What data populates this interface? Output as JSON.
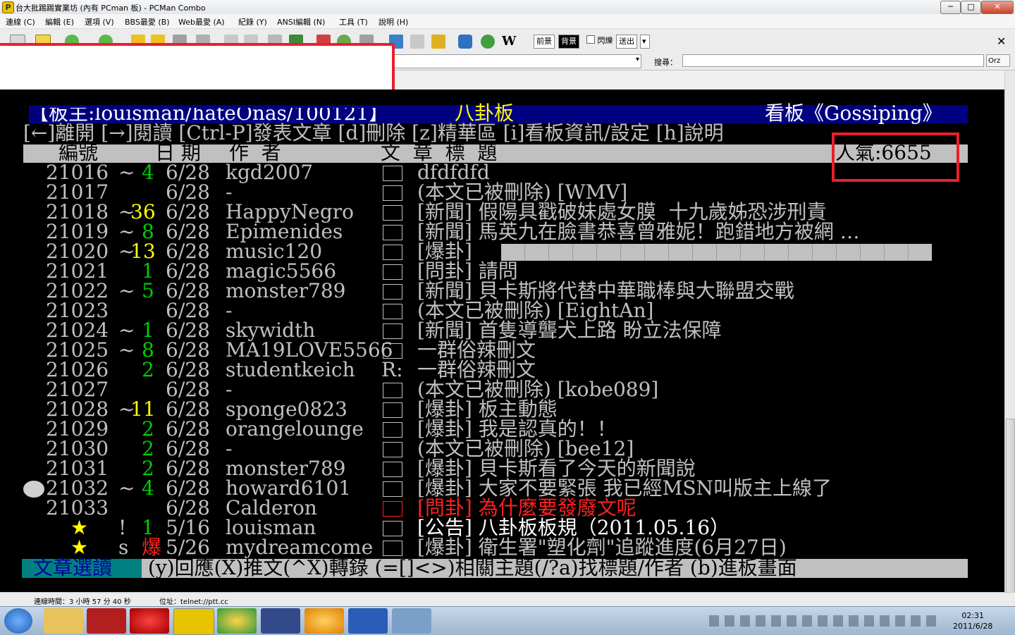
{
  "window": {
    "title": "台大批踢踢實業坊 (內有 PCman 板) - PCMan Combo",
    "minimize": "─",
    "maximize": "□",
    "close": "✕"
  },
  "menu": [
    "連線 (C)",
    "編輯 (E)",
    "選項 (V)",
    "BBS最愛 (B)",
    "Web最愛 (A)",
    "紀錄 (Y)",
    "ANSI編輯 (N)",
    "工具 (T)",
    "說明 (H)"
  ],
  "toolbar": {
    "foreground": "前景",
    "background": "背景",
    "blink": "閃爍",
    "output": "送出",
    "wiki": "W",
    "close_pane": "✕"
  },
  "search": {
    "label": "搜尋：",
    "value": "",
    "engine": "Orz"
  },
  "board": {
    "header_left": "【板主:louisman/hateOnas/100121】",
    "header_mid": "八卦板",
    "header_right": "看板《Gossiping》",
    "help_line": "[←]離開 [→]閱讀 [Ctrl-P]發表文章 [d]刪除 [z]精華區 [i]看板資訊/設定 [h]說明",
    "col_num": "編號",
    "col_date": "日 期",
    "col_author": "作  者",
    "col_title": "文  章  標  題",
    "popularity": "人氣:6655"
  },
  "posts": [
    {
      "num": "21016",
      "mark": "~",
      "recommend": "4",
      "date": "6/28",
      "author": "kgd2007",
      "box": "□",
      "title": "dfdfdfd",
      "rec_color": "g"
    },
    {
      "num": "21017",
      "mark": "",
      "recommend": "",
      "date": "6/28",
      "author": "-",
      "box": "□",
      "title": "(本文已被刪除) [WMV]",
      "rec_color": "g"
    },
    {
      "num": "21018",
      "mark": "~",
      "recommend": "36",
      "date": "6/28",
      "author": "HappyNegro",
      "box": "□",
      "title": "[新聞] 假陽具戳破妹處女膜  十九歲姊恐涉刑責",
      "rec_color": "y"
    },
    {
      "num": "21019",
      "mark": "~",
      "recommend": "8",
      "date": "6/28",
      "author": "Epimenides",
      "box": "□",
      "title": "[新聞] 馬英九在臉書恭喜曾雅妮！跑錯地方被網 …",
      "rec_color": "g"
    },
    {
      "num": "21020",
      "mark": "~",
      "recommend": "13",
      "date": "6/28",
      "author": "music120",
      "box": "□",
      "title": "[爆卦] ",
      "rec_color": "y"
    },
    {
      "num": "21021",
      "mark": "",
      "recommend": "1",
      "date": "6/28",
      "author": "magic5566",
      "box": "□",
      "title": "[問卦] 請問",
      "rec_color": "g"
    },
    {
      "num": "21022",
      "mark": "~",
      "recommend": "5",
      "date": "6/28",
      "author": "monster789",
      "box": "□",
      "title": "[新聞] 貝卡斯將代替中華職棒與大聯盟交戰",
      "rec_color": "g"
    },
    {
      "num": "21023",
      "mark": "",
      "recommend": "",
      "date": "6/28",
      "author": "-",
      "box": "□",
      "title": "(本文已被刪除) [EightAn]",
      "rec_color": "g"
    },
    {
      "num": "21024",
      "mark": "~",
      "recommend": "1",
      "date": "6/28",
      "author": "skywidth",
      "box": "□",
      "title": "[新聞] 首隻導聾犬上路 盼立法保障",
      "rec_color": "g"
    },
    {
      "num": "21025",
      "mark": "~",
      "recommend": "8",
      "date": "6/28",
      "author": "MA19LOVE5566",
      "box": "□",
      "title": "一群俗辣刪文",
      "rec_color": "g"
    },
    {
      "num": "21026",
      "mark": "",
      "recommend": "2",
      "date": "6/28",
      "author": "studentkeich",
      "box": "R:",
      "title": "一群俗辣刪文",
      "rec_color": "g"
    },
    {
      "num": "21027",
      "mark": "",
      "recommend": "",
      "date": "6/28",
      "author": "-",
      "box": "□",
      "title": "(本文已被刪除) [kobe089]",
      "rec_color": "g"
    },
    {
      "num": "21028",
      "mark": "~",
      "recommend": "11",
      "date": "6/28",
      "author": "sponge0823",
      "box": "□",
      "title": "[爆卦] 板主動態",
      "rec_color": "y"
    },
    {
      "num": "21029",
      "mark": "",
      "recommend": "2",
      "date": "6/28",
      "author": "orangelounge",
      "box": "□",
      "title": "[爆卦] 我是認真的！！",
      "rec_color": "g"
    },
    {
      "num": "21030",
      "mark": "",
      "recommend": "2",
      "date": "6/28",
      "author": "-",
      "box": "□",
      "title": "(本文已被刪除) [bee12]",
      "rec_color": "g"
    },
    {
      "num": "21031",
      "mark": "",
      "recommend": "2",
      "date": "6/28",
      "author": "monster789",
      "box": "□",
      "title": "[爆卦] 貝卡斯看了今天的新聞說",
      "rec_color": "g"
    },
    {
      "num": "21032",
      "mark": "~",
      "recommend": "4",
      "date": "6/28",
      "author": "howard6101",
      "box": "□",
      "title": "[爆卦] 大家不要緊張 我已經MSN叫版主上線了",
      "rec_color": "g"
    },
    {
      "num": "21033",
      "mark": "",
      "recommend": "",
      "date": "6/28",
      "author": "Calderon",
      "box": "□",
      "title": "[問卦] 為什麼要發廢文呢",
      "rec_color": "g"
    },
    {
      "num": "★",
      "mark": "!",
      "recommend": "1",
      "date": "5/16",
      "author": "louisman",
      "box": "□",
      "title": "[公告] 八卦板板規（2011.05.16）",
      "rec_color": "g"
    },
    {
      "num": "★",
      "mark": "s",
      "recommend": "爆",
      "date": "5/26",
      "author": "mydreamcome",
      "box": "□",
      "title": "[爆卦] 衛生署\"塑化劑\"追蹤進度(6月27日)",
      "rec_color": "r"
    }
  ],
  "footer": {
    "mode": "文章選讀",
    "keys": " (y)回應(X)推文(^X)轉錄 (=[]<>)相關主題(/?a)找標題/作者 (b)進板畫面"
  },
  "status": {
    "connection_time": "連線時間：3 小時 57 分 40 秒",
    "address": "位址：telnet://ptt.cc"
  },
  "clock": {
    "time": "02:31",
    "date": "2011/6/28"
  },
  "colors": {
    "terminal_bg": "#000000",
    "highlight_red": "#e8202d",
    "header_blue": "#000080",
    "bar_gray": "#c0c0c0"
  }
}
